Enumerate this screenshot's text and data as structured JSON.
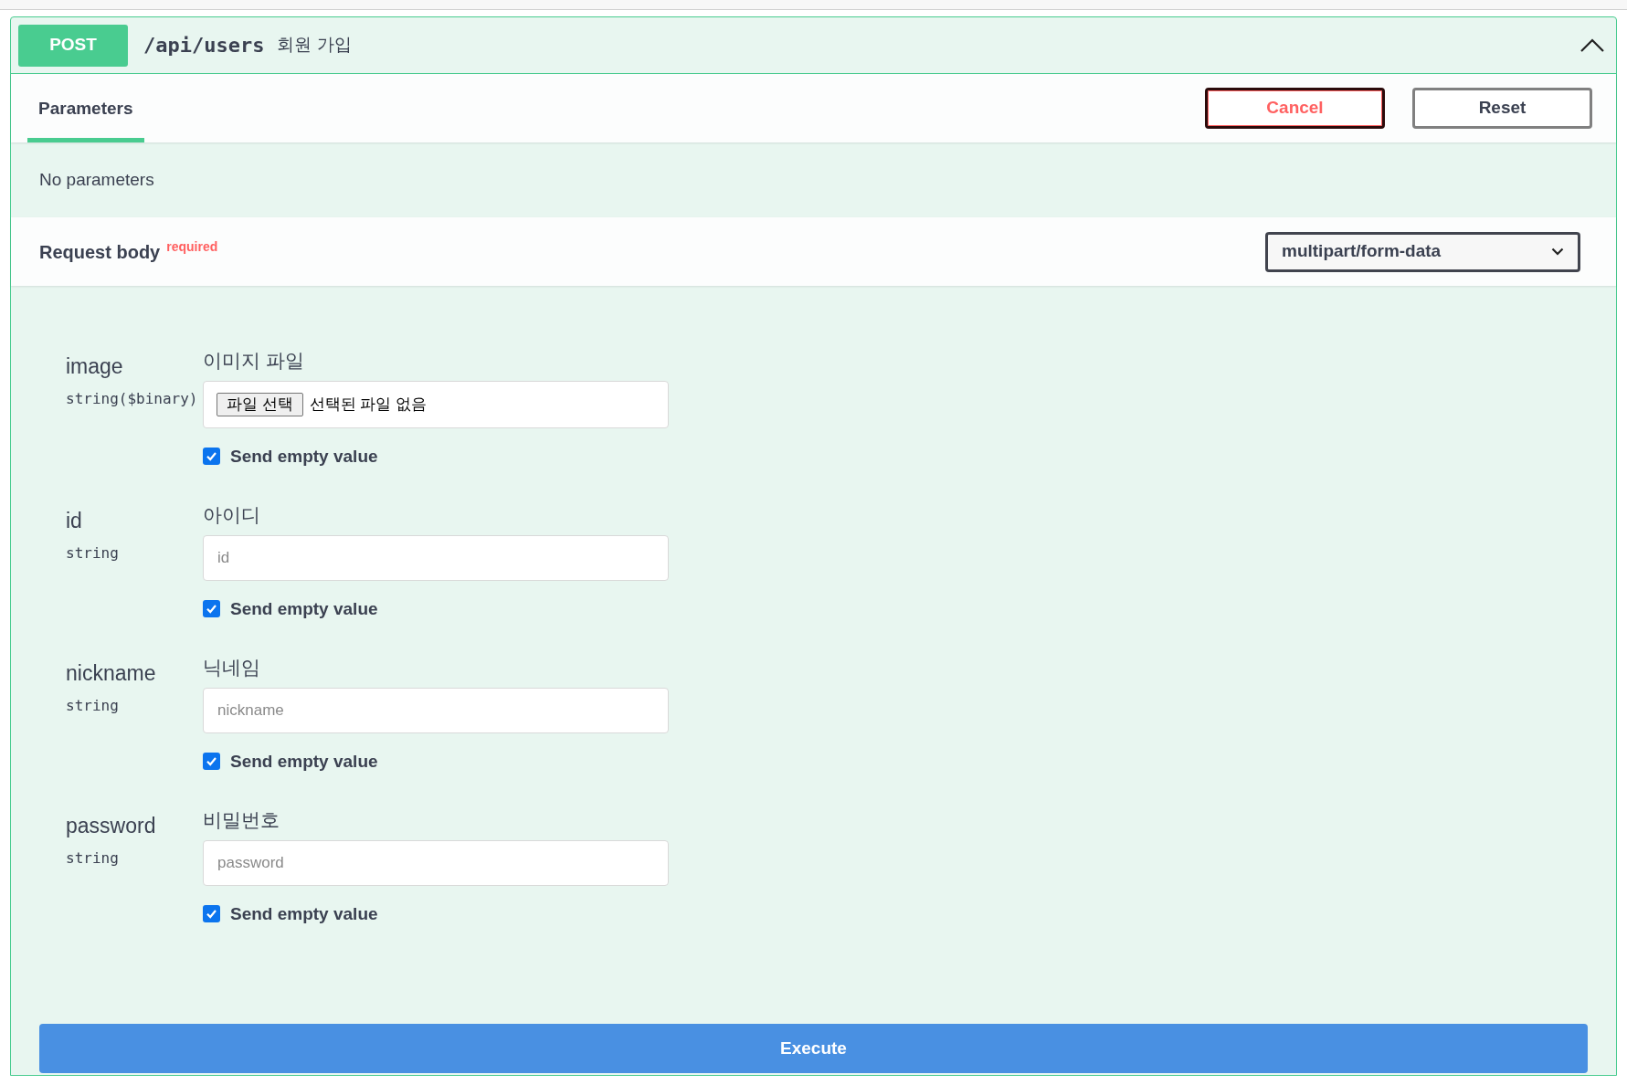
{
  "operation": {
    "method": "POST",
    "path": "/api/users",
    "summary": "회원 가입",
    "expanded": true
  },
  "tabs": [
    {
      "label": "Parameters",
      "selected": true
    }
  ],
  "buttons": [
    {
      "kind": "cancel",
      "label": "Cancel"
    },
    {
      "kind": "reset",
      "label": "Reset"
    }
  ],
  "parameters_message": "No parameters",
  "request_body": {
    "title": "Request body",
    "required_label": "required",
    "content_type": "multipart/form-data",
    "fields": [
      {
        "kind": "file",
        "name": "image",
        "type": "string($binary)",
        "description": "이미지 파일",
        "file_button": "파일 선택",
        "file_status": "선택된 파일 없음",
        "send_empty": {
          "label": "Send empty value",
          "checked": true
        }
      },
      {
        "kind": "text",
        "name": "id",
        "type": "string",
        "description": "아이디",
        "placeholder": "id",
        "send_empty": {
          "label": "Send empty value",
          "checked": true
        }
      },
      {
        "kind": "text",
        "name": "nickname",
        "type": "string",
        "description": "닉네임",
        "placeholder": "nickname",
        "send_empty": {
          "label": "Send empty value",
          "checked": true
        }
      },
      {
        "kind": "text",
        "name": "password",
        "type": "string",
        "description": "비밀번호",
        "placeholder": "password",
        "send_empty": {
          "label": "Send empty value",
          "checked": true
        }
      }
    ]
  },
  "execute_label": "Execute"
}
